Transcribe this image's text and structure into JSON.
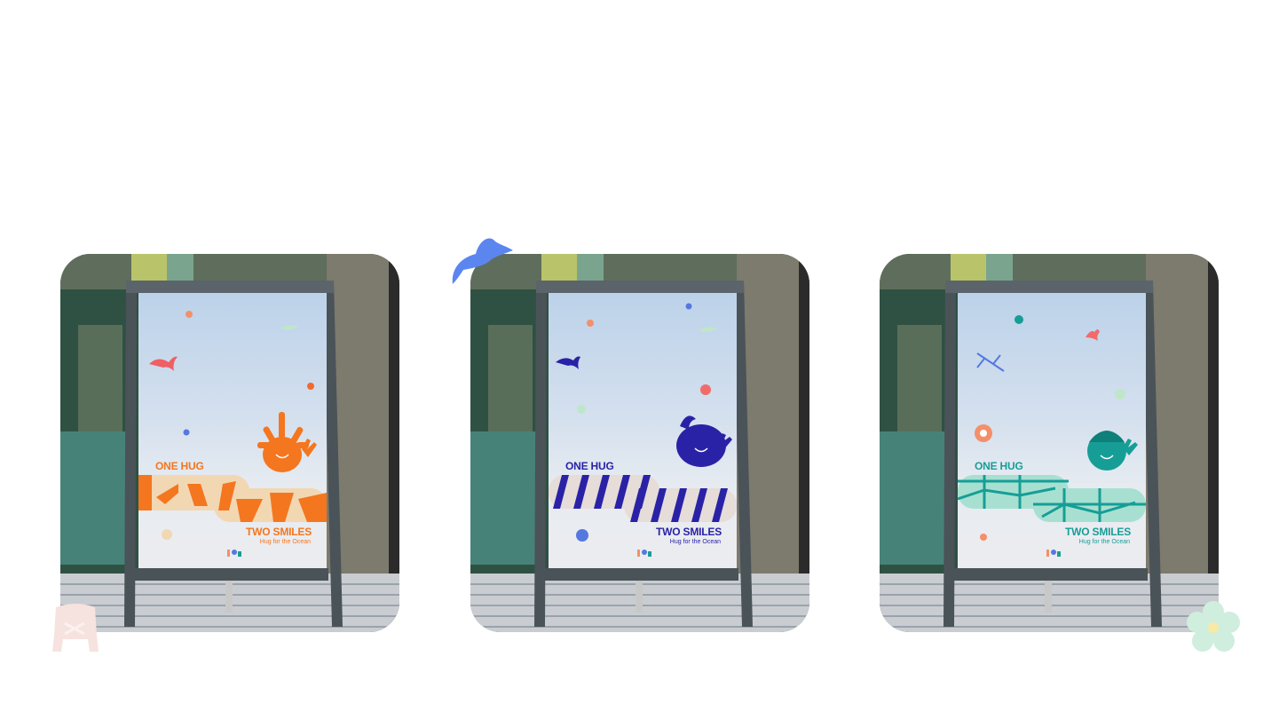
{
  "posters": [
    {
      "theme": "coral",
      "accent": "#f4761f",
      "band_fill": "#f2d7b3",
      "headline_top": "ONE HUG",
      "headline_bottom": "TWO SMILES",
      "tagline": "Hug for the Ocean",
      "mascot_icon": "coral-mascot-icon",
      "pattern": "chevron-pattern"
    },
    {
      "theme": "whale",
      "accent": "#2a22a6",
      "band_fill": "#e6dcd8",
      "headline_top": "ONE HUG",
      "headline_bottom": "TWO SMILES",
      "tagline": "Hug for the Ocean",
      "mascot_icon": "whale-mascot-icon",
      "pattern": "stripe-pattern"
    },
    {
      "theme": "turtle",
      "accent": "#169e96",
      "band_fill": "#a7e0d1",
      "headline_top": "ONE HUG",
      "headline_bottom": "TWO SMILES",
      "tagline": "Hug for the Ocean",
      "mascot_icon": "turtle-mascot-icon",
      "pattern": "shell-pattern"
    }
  ],
  "decorations": {
    "bird": {
      "icon": "bird-icon",
      "color": "#5b86f0"
    },
    "chair": {
      "icon": "chair-icon",
      "color": "#f6e2df"
    },
    "flower": {
      "icon": "flower-icon",
      "color": "#cfeedd"
    }
  }
}
